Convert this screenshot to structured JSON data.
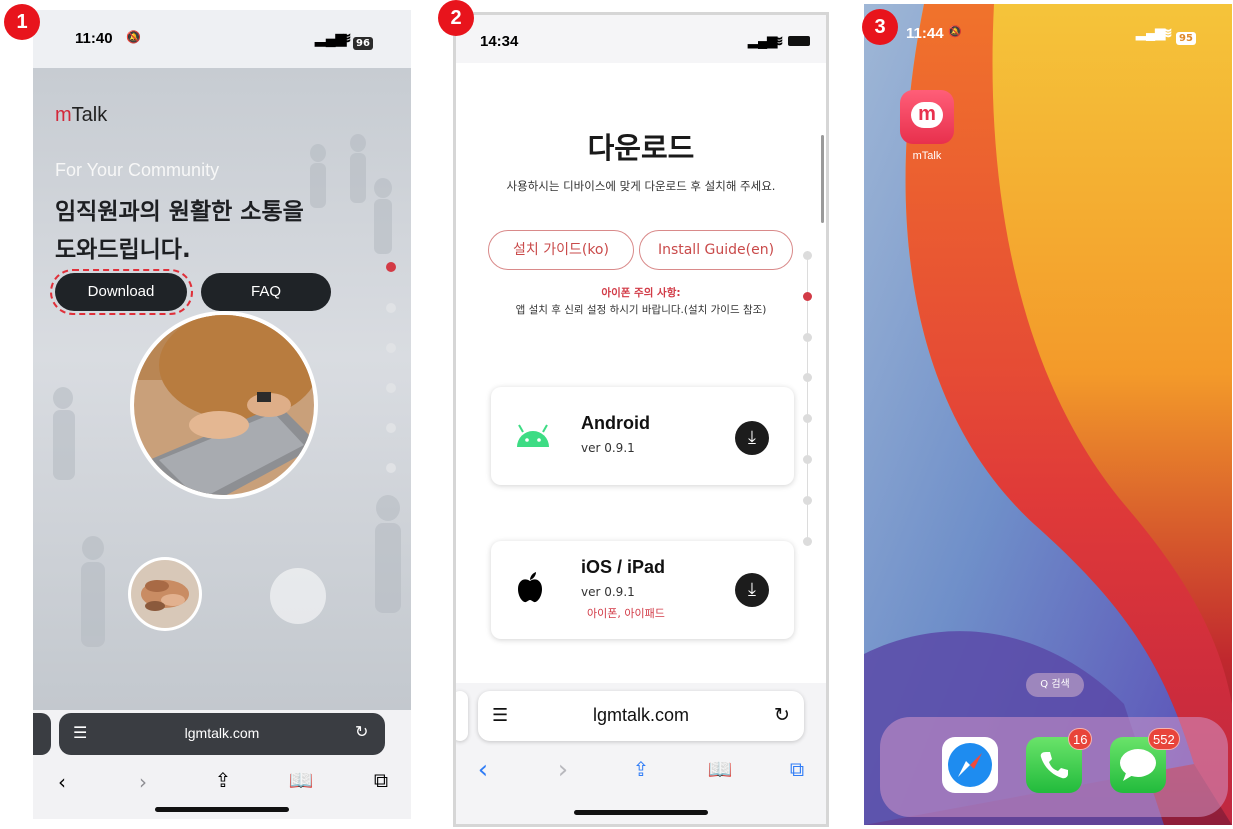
{
  "markers": [
    "1",
    "2",
    "3"
  ],
  "phone1": {
    "status": {
      "time": "11:40",
      "battery": "96"
    },
    "brand": {
      "prefix": "m",
      "rest": "Talk"
    },
    "tagline": "For Your Community",
    "headline_line1": "임직원과의 원활한 소통을",
    "headline_line2": "도와드립니다.",
    "buttons": {
      "download": "Download",
      "faq": "FAQ"
    },
    "url": "lgmtalk.com",
    "toolbar_icons": [
      "back-icon",
      "forward-icon",
      "share-icon",
      "bookmarks-icon",
      "tabs-icon"
    ]
  },
  "phone2": {
    "status": {
      "time": "14:34"
    },
    "title": "다운로드",
    "subtitle": "사용하시는 디바이스에 맞게 다운로드 후 설치해 주세요.",
    "guide_ko": "설치 가이드(ko)",
    "guide_en": "Install Guide(en)",
    "notice_title": "아이폰 주의 사항:",
    "notice_body": "앱 설치 후 신뢰 설정 하시기 바랍니다.(설치 가이드 참조)",
    "cards": [
      {
        "platform": "Android",
        "version": "ver 0.9.1",
        "note": ""
      },
      {
        "platform": "iOS / iPad",
        "version": "ver 0.9.1",
        "note": "아이폰, 아이패드"
      }
    ],
    "url": "lgmtalk.com"
  },
  "phone3": {
    "status": {
      "time": "11:44",
      "battery": "95"
    },
    "app": {
      "name": "mTalk",
      "glyph": "m"
    },
    "search": "Q 검색",
    "dock": [
      {
        "app": "Safari",
        "badge": ""
      },
      {
        "app": "Phone",
        "badge": "16"
      },
      {
        "app": "Messages",
        "badge": "552"
      }
    ]
  }
}
